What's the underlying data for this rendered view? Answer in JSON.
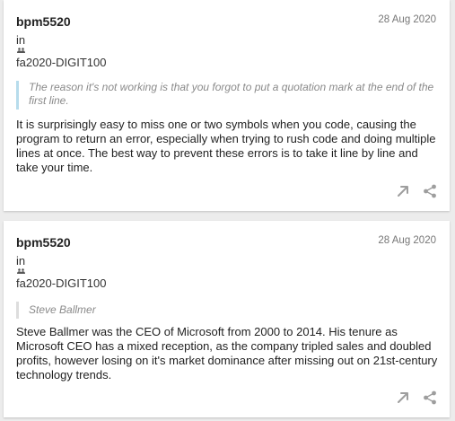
{
  "posts": [
    {
      "author": "bpm5520",
      "date": "28 Aug 2020",
      "in_label": "in",
      "group_icon": "group-icon",
      "group": "fa2020-DIGIT100",
      "quote": "The reason it's not working is that you forgot to put a quotation mark at the end of the first line.",
      "body": "It is surprisingly easy to miss one or two symbols when you code, causing the program to return an error, especially when trying to rush code and doing multiple lines at once. The best way to prevent these errors is to take it line by line and take your time.",
      "quote_bar_color": "#b7dcec",
      "actions": [
        "open-arrow-icon",
        "share-icon"
      ]
    },
    {
      "author": "bpm5520",
      "date": "28 Aug 2020",
      "in_label": "in",
      "group_icon": "group-icon",
      "group": "fa2020-DIGIT100",
      "quote": "Steve Ballmer",
      "body": "Steve Ballmer was the CEO of Microsoft from 2000 to 2014. His tenure as Microsoft CEO has a mixed reception, as the company tripled sales and doubled profits, however losing on it's market dominance after missing out on 21st-century technology trends.",
      "quote_bar_color": "#dddddd",
      "actions": [
        "open-arrow-icon",
        "share-icon"
      ]
    }
  ],
  "colors": {
    "background": "#ececec",
    "card": "#ffffff",
    "text": "#222222",
    "muted": "#777777",
    "icon": "#9e9e9e"
  }
}
